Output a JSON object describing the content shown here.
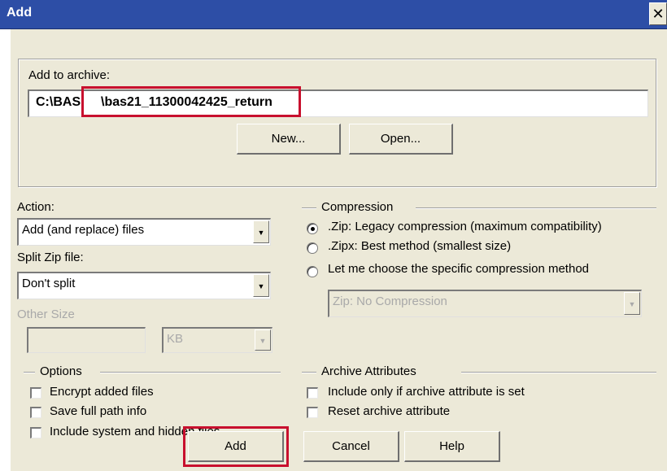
{
  "window": {
    "title": "Add",
    "close_glyph": "✕"
  },
  "archive": {
    "label": "Add to archive:",
    "path_prefix": "C:\\BAS",
    "path_name": "\\bas21_11300042425_return",
    "new_label": "New...",
    "open_label": "Open..."
  },
  "action": {
    "label": "Action:",
    "value": "Add (and replace) files"
  },
  "split": {
    "label": "Split Zip file:",
    "value": "Don't split",
    "other_size_label": "Other Size",
    "unit": "KB"
  },
  "compression": {
    "title": "Compression",
    "options": [
      {
        "label": ".Zip: Legacy compression (maximum compatibility)",
        "checked": true
      },
      {
        "label": ".Zipx: Best method (smallest size)",
        "checked": false
      },
      {
        "label": "Let me choose the specific compression method",
        "checked": false
      }
    ],
    "method_value": "Zip: No Compression"
  },
  "options": {
    "title": "Options",
    "items": [
      {
        "label": "Encrypt added files",
        "checked": false
      },
      {
        "label": "Save full path info",
        "checked": false
      },
      {
        "label": "Include system and hidden files",
        "checked": false
      }
    ]
  },
  "attributes": {
    "title": "Archive Attributes",
    "items": [
      {
        "label": "Include only if archive attribute is set",
        "checked": false
      },
      {
        "label": "Reset archive attribute",
        "checked": false
      }
    ]
  },
  "buttons": {
    "add": "Add",
    "cancel": "Cancel",
    "help": "Help"
  },
  "colors": {
    "titlebar": "#2d4ea6",
    "highlight": "#c8102e",
    "face": "#ece9d8"
  }
}
